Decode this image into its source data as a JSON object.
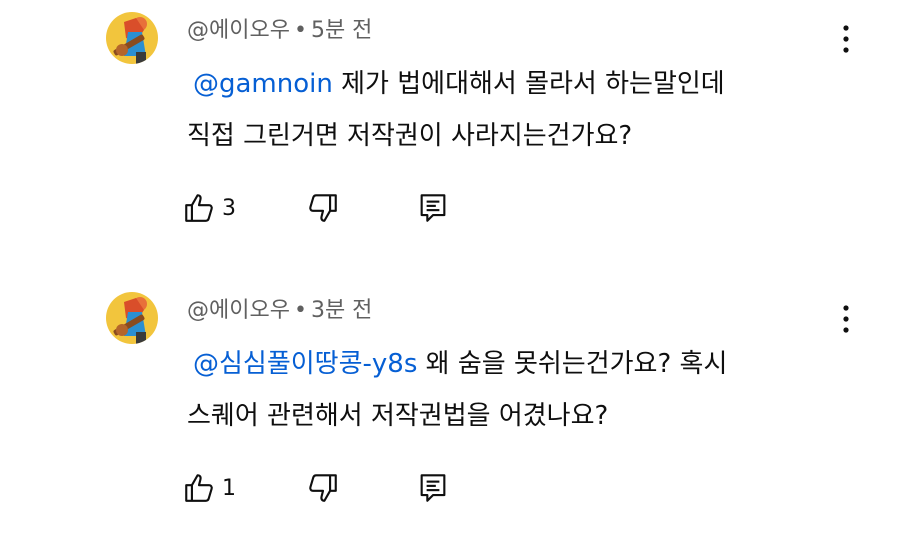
{
  "comments": [
    {
      "author": "@에이오우",
      "separator": "•",
      "time": "5분 전",
      "mention": "@gamnoin",
      "text_line1": "제가 법에대해서 몰라서 하는말인데",
      "text_line2": "직접 그린거면 저작권이 사라지는건가요?",
      "likes": "3"
    },
    {
      "author": "@에이오우",
      "separator": "•",
      "time": "3분 전",
      "mention": "@심심풀이땅콩-y8s",
      "text_line1": "왜 숨을 못쉬는건가요? 혹시",
      "text_line2": "스퀘어 관련해서 저작권법을 어겼나요?",
      "likes": "1"
    }
  ],
  "icons": {
    "avatar": "guitar-player-avatar-icon",
    "menu": "more-vert-icon",
    "like": "thumbs-up-icon",
    "dislike": "thumbs-down-icon",
    "reply": "reply-comment-icon"
  },
  "colors": {
    "mention": "#065fd4",
    "meta": "#606060",
    "text": "#0f0f0f",
    "avatar_bg": "#f2c53d"
  }
}
